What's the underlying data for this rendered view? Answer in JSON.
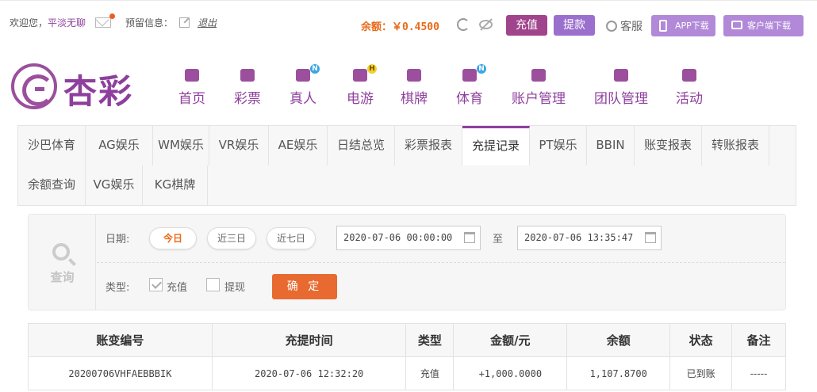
{
  "topbar": {
    "welcome": "欢迎您，",
    "username": "平淡无聊",
    "alert_label": "预留信息：",
    "logout": "退出",
    "balance": "余额：￥0.4500",
    "deposit": "充值",
    "withdraw": "提款",
    "service": "客服",
    "app_download": "APP下载",
    "client_download": "客户端下载"
  },
  "logo": {
    "text": "杏彩"
  },
  "nav": [
    {
      "label": "首页",
      "icon": "home-icon",
      "badge": ""
    },
    {
      "label": "彩票",
      "icon": "lottery-icon",
      "badge": ""
    },
    {
      "label": "真人",
      "icon": "live-dealer-icon",
      "badge": "N"
    },
    {
      "label": "电游",
      "icon": "gamepad-icon",
      "badge": "H"
    },
    {
      "label": "棋牌",
      "icon": "cards-icon",
      "badge": ""
    },
    {
      "label": "体育",
      "icon": "trophy-icon",
      "badge": "N"
    },
    {
      "label": "账户管理",
      "icon": "yen-icon",
      "badge": ""
    },
    {
      "label": "团队管理",
      "icon": "team-icon",
      "badge": ""
    },
    {
      "label": "活动",
      "icon": "gift-icon",
      "badge": ""
    }
  ],
  "tabs": [
    "沙巴体育",
    "AG娱乐",
    "WM娱乐",
    "VR娱乐",
    "AE娱乐",
    "日结总览",
    "彩票报表",
    "充提记录",
    "PT娱乐",
    "BBIN",
    "账变报表",
    "转账报表",
    "余额查询",
    "VG娱乐",
    "KG棋牌"
  ],
  "active_tab": "充提记录",
  "query": {
    "side_label": "查询",
    "date_label": "日期:",
    "today": "今日",
    "three_days": "近三日",
    "seven_days": "近七日",
    "start": "2020-07-06 00:00:00",
    "to": "至",
    "end": "2020-07-06 13:35:47",
    "type_label": "类型:",
    "type_deposit": "充值",
    "type_deposit_checked": true,
    "type_withdraw": "提现",
    "type_withdraw_checked": false,
    "confirm": "确 定"
  },
  "table": {
    "headers": [
      "账变编号",
      "充提时间",
      "类型",
      "金额/元",
      "余额",
      "状态",
      "备注"
    ],
    "rows": [
      [
        "20200706VHFAEBBBIK",
        "2020-07-06 12:32:20",
        "充值",
        "+1,000.0000",
        "1,107.8700",
        "已到账",
        "-----"
      ]
    ]
  },
  "colors": {
    "brand": "#8e3f9d",
    "accent": "#e86a18",
    "success": "#2e9a2e",
    "amount": "#d9302c"
  }
}
